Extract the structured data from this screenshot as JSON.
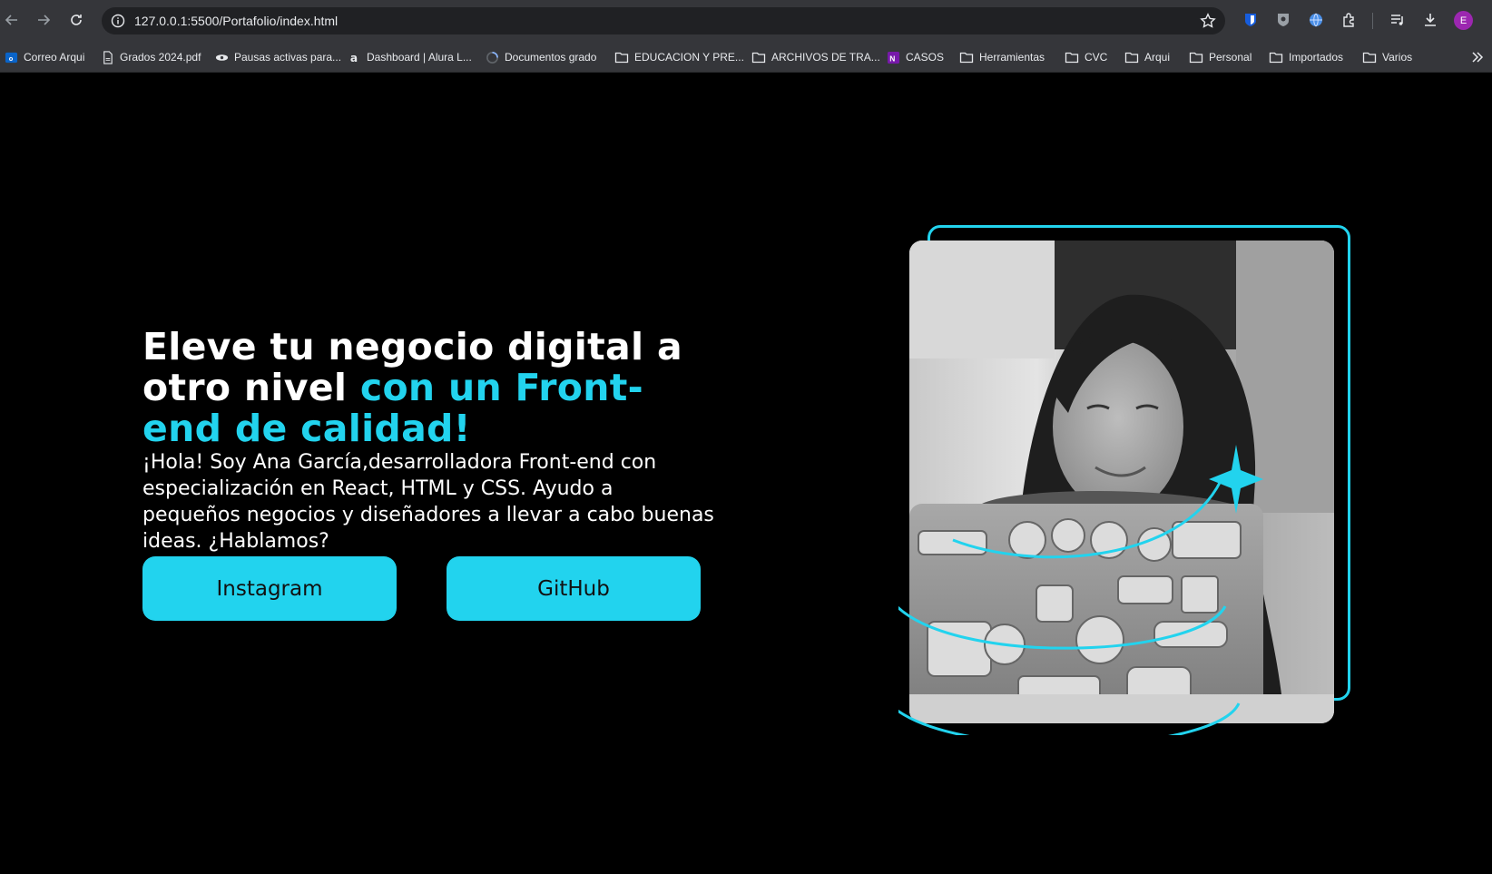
{
  "browser": {
    "url": "127.0.0.1:5500/Portafolio/index.html",
    "avatar_initial": "E",
    "bookmarks": [
      {
        "label": "Correo Arqui",
        "icon": "outlook-icon"
      },
      {
        "label": "Grados 2024.pdf",
        "icon": "pdf-icon"
      },
      {
        "label": "Pausas activas para...",
        "icon": "eye-icon"
      },
      {
        "label": "Dashboard | Alura L...",
        "icon": "alura-icon"
      },
      {
        "label": "Documentos grado",
        "icon": "loading-icon"
      },
      {
        "label": "EDUCACION Y PRE...",
        "icon": "folder-icon"
      },
      {
        "label": "ARCHIVOS DE TRA...",
        "icon": "folder-icon"
      },
      {
        "label": "CASOS",
        "icon": "onenote-icon"
      },
      {
        "label": "Herramientas",
        "icon": "folder-icon"
      },
      {
        "label": "CVC",
        "icon": "folder-icon"
      },
      {
        "label": "Arqui",
        "icon": "folder-icon"
      },
      {
        "label": "Personal",
        "icon": "folder-icon"
      },
      {
        "label": "Importados",
        "icon": "folder-icon"
      },
      {
        "label": "Varios",
        "icon": "folder-icon"
      }
    ]
  },
  "hero": {
    "title_plain": "Eleve tu negocio digital a otro nivel ",
    "title_accent": "con un Front-end de calidad!",
    "description": "¡Hola! Soy Ana García,desarrolladora Front-end con especialización en React, HTML y CSS. Ayudo a pequeños negocios y diseñadores a llevar a cabo buenas ideas. ¿Hablamos?",
    "buttons": {
      "instagram": "Instagram",
      "github": "GitHub"
    }
  },
  "colors": {
    "accent": "#22d3ee",
    "background": "#000000",
    "chrome": "#35363a"
  }
}
